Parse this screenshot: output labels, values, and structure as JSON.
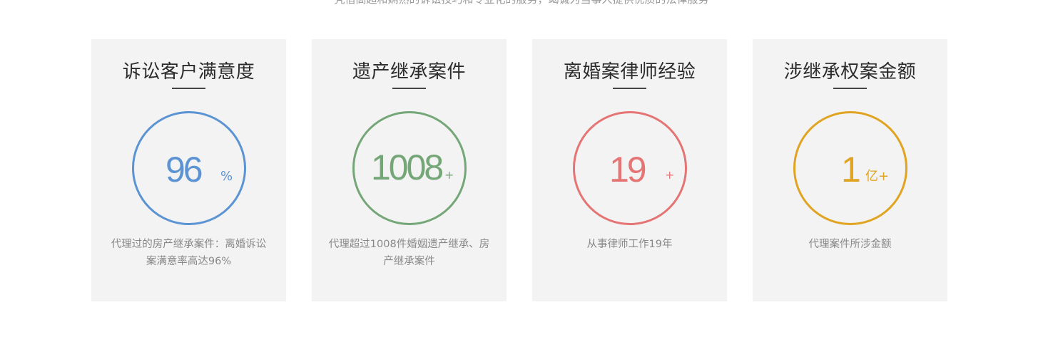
{
  "top_text": "凭借高超和娴熟的诉讼技巧和专业化的服务，竭诚为当事人提供优质的法律服务",
  "colors": {
    "blue": "#5b93d3",
    "green": "#74a677",
    "red": "#e57474",
    "orange": "#e0a422"
  },
  "cards": [
    {
      "title": "诉讼客户满意度",
      "number": "96",
      "unit": "%",
      "desc": "代理过的房产继承案件：离婚诉讼案满意率高达96%"
    },
    {
      "title": "遗产继承案件",
      "number": "1008",
      "unit": "+",
      "desc": "代理超过1008件婚姻遗产继承、房产继承案件"
    },
    {
      "title": "离婚案律师经验",
      "number": "19",
      "unit": "+",
      "desc": "从事律师工作19年"
    },
    {
      "title": "涉继承权案金额",
      "number": "1",
      "unit": "亿+",
      "desc": "代理案件所涉金额"
    }
  ]
}
